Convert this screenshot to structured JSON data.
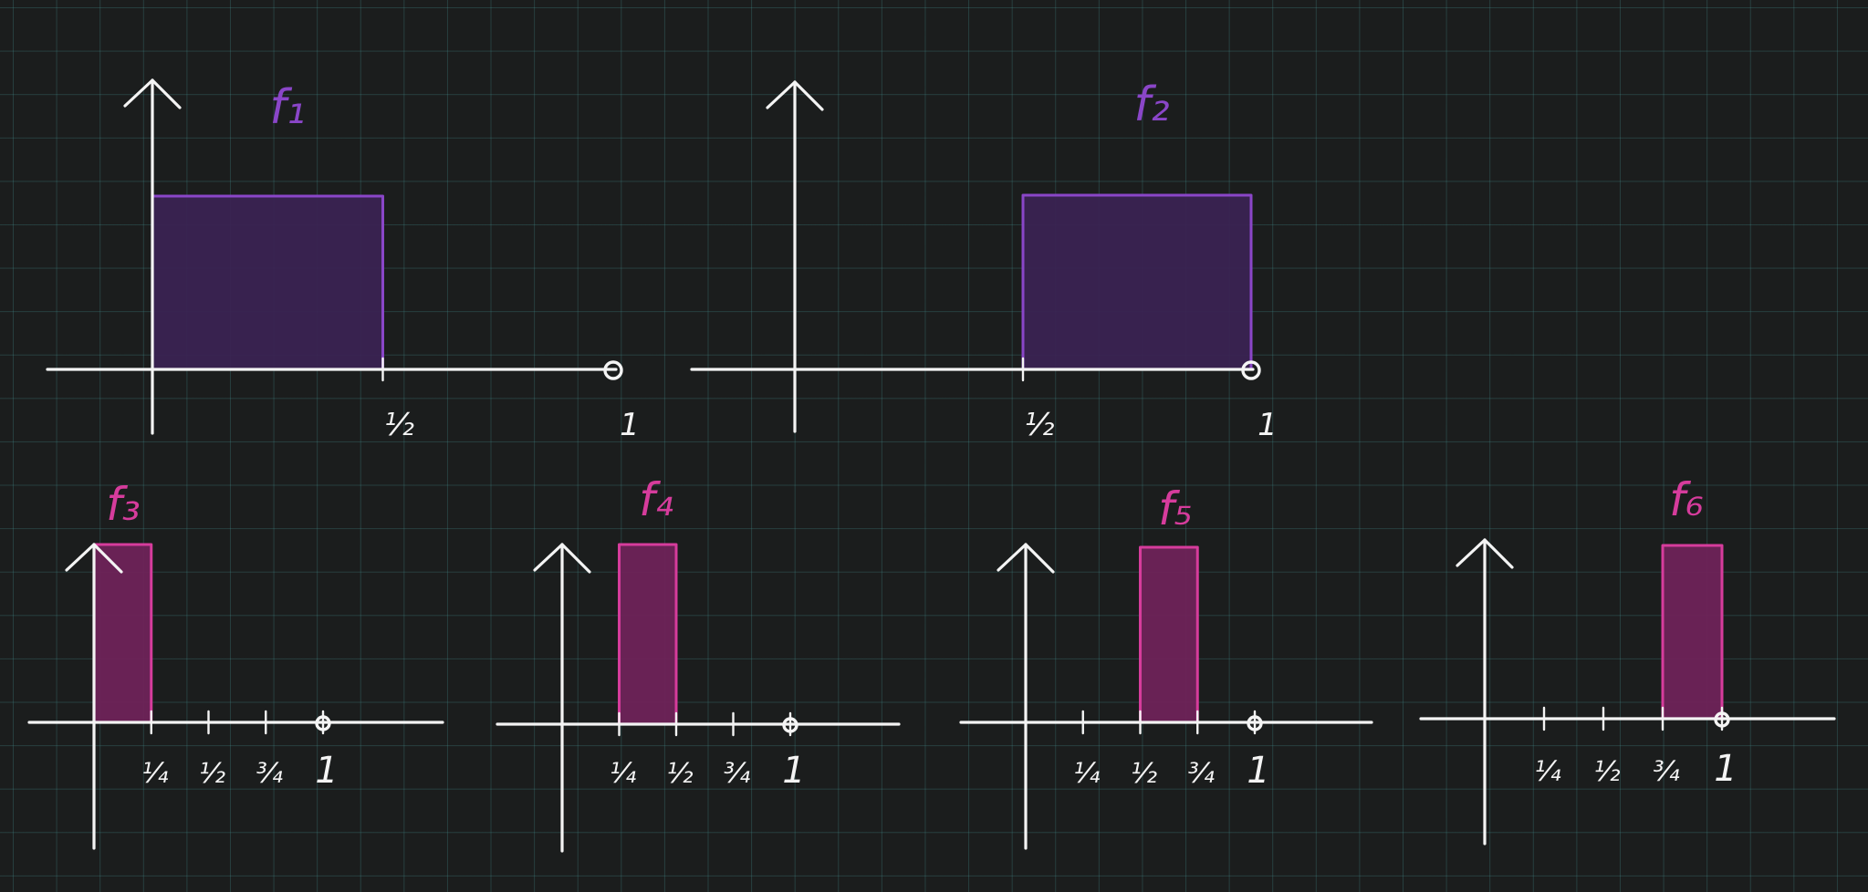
{
  "colors": {
    "background": "#1b1d1d",
    "axis": "#f4f4f4",
    "purple_edge": "#8a46c8",
    "purple_fill": "#3a2352",
    "magenta_edge": "#d63c9c",
    "magenta_fill": "#6e2358"
  },
  "chart_data": [
    {
      "type": "area",
      "title": "f₁",
      "xlim": [
        0,
        1
      ],
      "ylim": [
        0,
        1
      ],
      "tick_labels": [
        "½",
        "1"
      ],
      "interval": [
        0,
        0.5
      ],
      "height": 1,
      "open_endpoint": 1
    },
    {
      "type": "area",
      "title": "f₂",
      "xlim": [
        0,
        1
      ],
      "ylim": [
        0,
        1
      ],
      "tick_labels": [
        "½",
        "1"
      ],
      "interval": [
        0.5,
        1
      ],
      "height": 1,
      "open_endpoint": 1
    },
    {
      "type": "area",
      "title": "f₃",
      "xlim": [
        0,
        1
      ],
      "ylim": [
        0,
        1
      ],
      "tick_labels": [
        "¼",
        "½",
        "¾",
        "1"
      ],
      "interval": [
        0,
        0.25
      ],
      "height": 1,
      "open_endpoint": 1
    },
    {
      "type": "area",
      "title": "f₄",
      "xlim": [
        0,
        1
      ],
      "ylim": [
        0,
        1
      ],
      "tick_labels": [
        "¼",
        "½",
        "¾",
        "1"
      ],
      "interval": [
        0.25,
        0.5
      ],
      "height": 1,
      "open_endpoint": 1
    },
    {
      "type": "area",
      "title": "f₅",
      "xlim": [
        0,
        1
      ],
      "ylim": [
        0,
        1
      ],
      "tick_labels": [
        "¼",
        "½",
        "¾",
        "1"
      ],
      "interval": [
        0.5,
        0.75
      ],
      "height": 1,
      "open_endpoint": 1
    },
    {
      "type": "area",
      "title": "f₆",
      "xlim": [
        0,
        1
      ],
      "ylim": [
        0,
        1
      ],
      "tick_labels": [
        "¼",
        "½",
        "¾",
        "1"
      ],
      "interval": [
        0.75,
        1
      ],
      "height": 1,
      "open_endpoint": 1
    }
  ]
}
